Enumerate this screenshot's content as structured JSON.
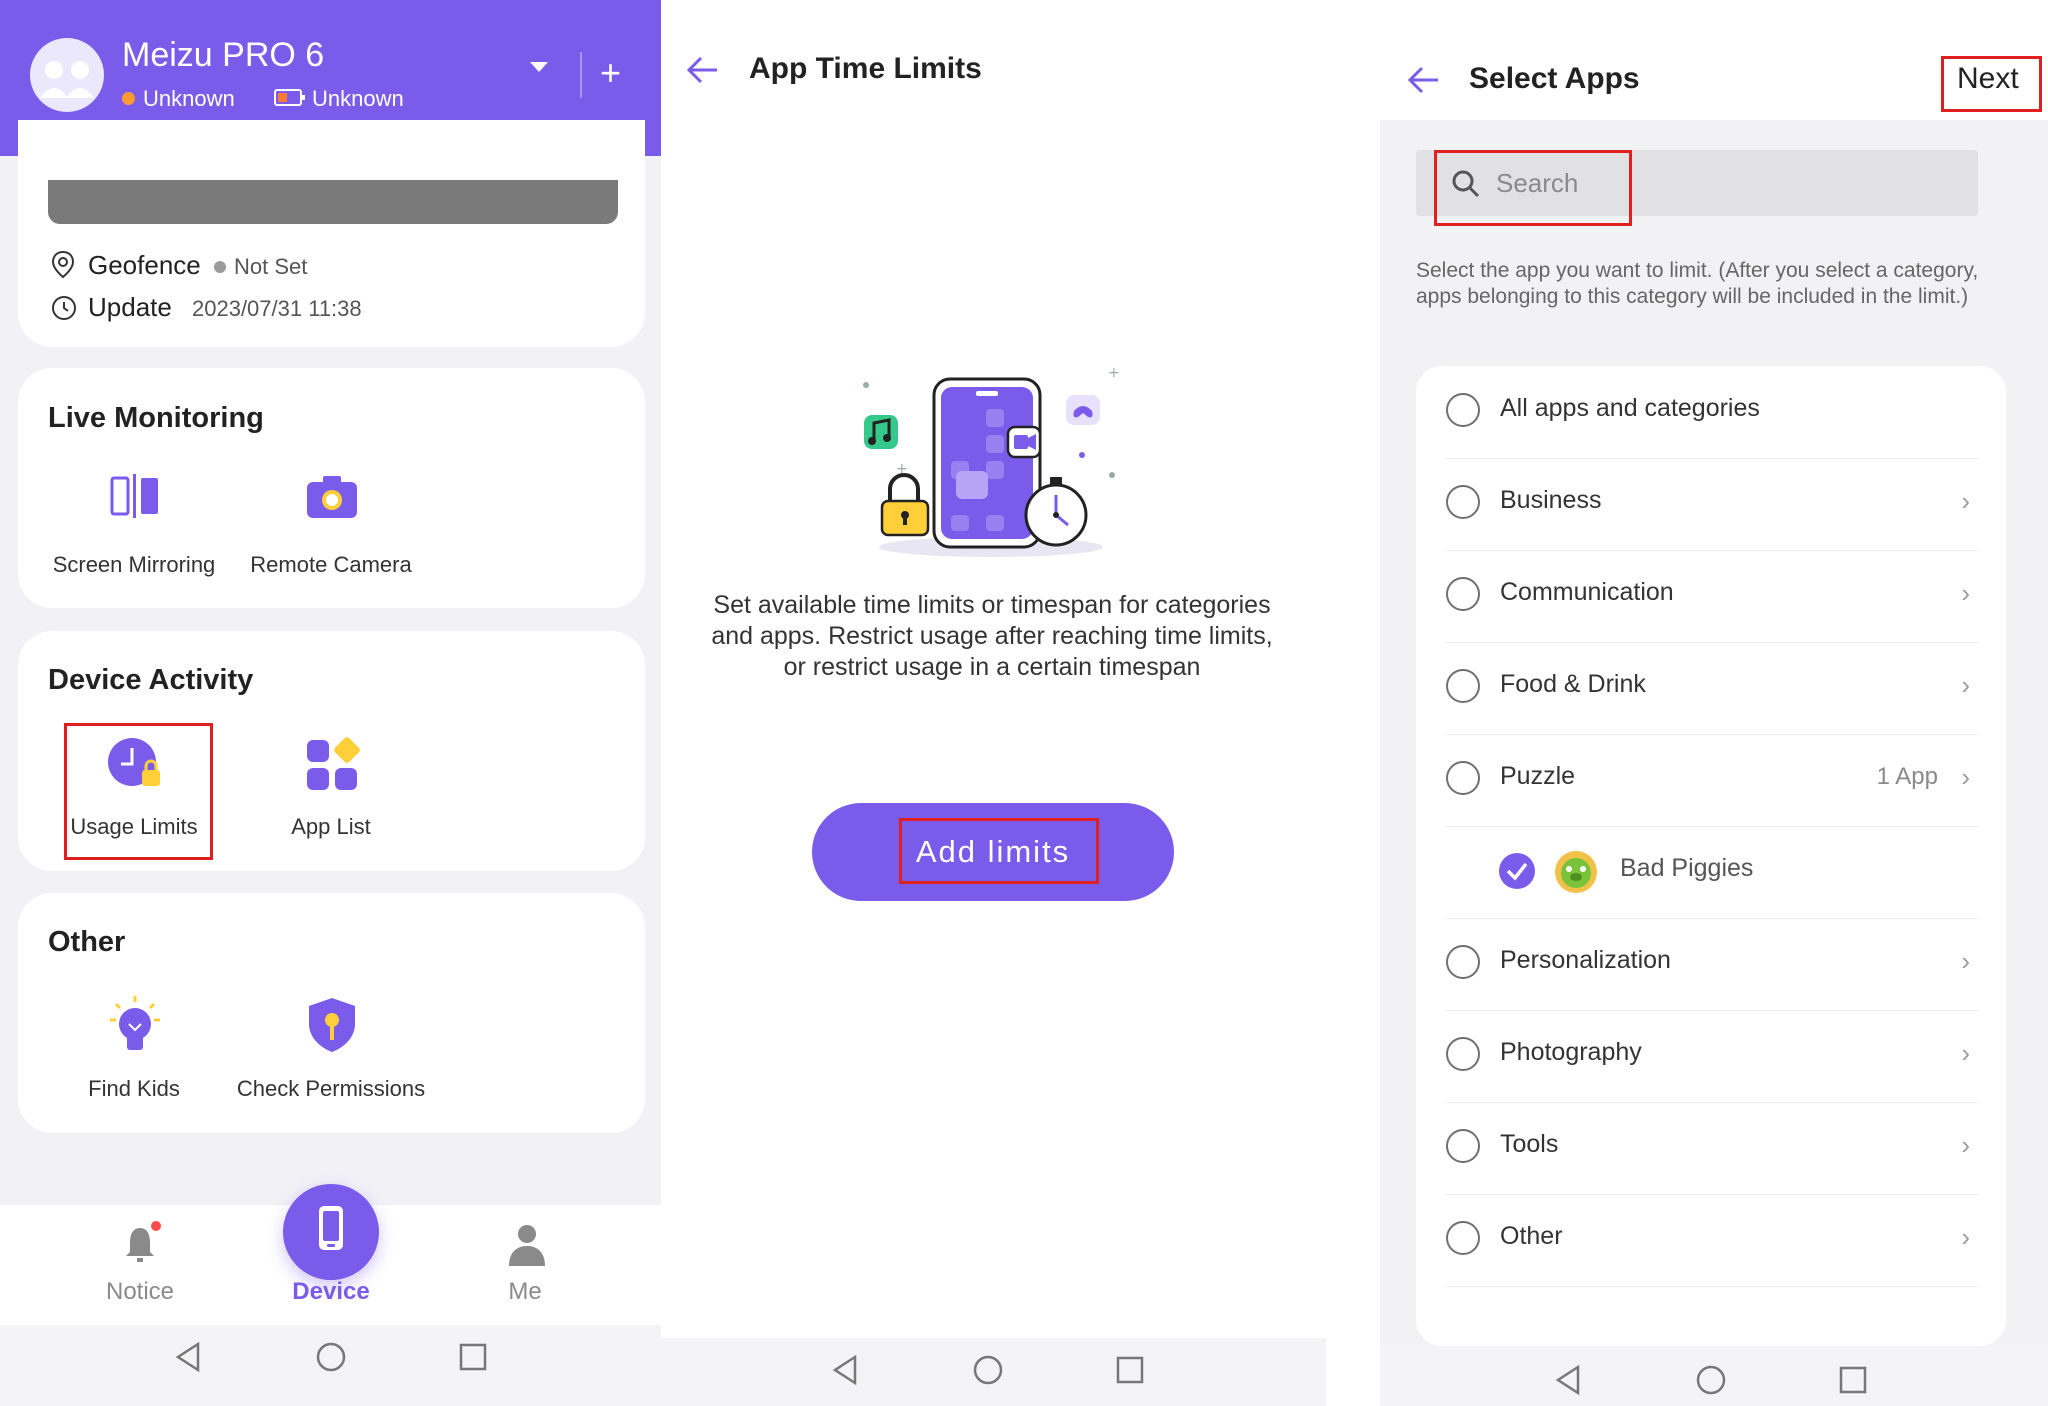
{
  "colors": {
    "accent": "#7b5bea",
    "highlight": "#e02020",
    "status_dot": "#ff9b30"
  },
  "panel1": {
    "device_name": "Meizu PRO 6",
    "status_location": "Unknown",
    "status_battery": "Unknown",
    "geofence_label": "Geofence",
    "geofence_value": "Not Set",
    "update_label": "Update",
    "update_value": "2023/07/31 11:38",
    "live_monitoring": {
      "title": "Live Monitoring",
      "items": [
        "Screen Mirroring",
        "Remote Camera"
      ]
    },
    "device_activity": {
      "title": "Device Activity",
      "items": [
        "Usage Limits",
        "App List"
      ]
    },
    "other": {
      "title": "Other",
      "items": [
        "Find Kids",
        "Check Permissions"
      ]
    },
    "nav": {
      "notice": "Notice",
      "device": "Device",
      "me": "Me"
    }
  },
  "panel2": {
    "title": "App Time Limits",
    "description": "Set available time limits or timespan for categories and apps. Restrict usage after reaching time limits, or restrict usage in a certain timespan",
    "add_button": "Add limits"
  },
  "panel3": {
    "title": "Select Apps",
    "next": "Next",
    "search_placeholder": "Search",
    "hint": "Select the app you want to limit. (After you select a category, apps belonging to this category will be included in the limit.)",
    "list": [
      {
        "label": "All apps and categories"
      },
      {
        "label": "Business"
      },
      {
        "label": "Communication"
      },
      {
        "label": "Food & Drink"
      },
      {
        "label": "Puzzle",
        "count": "1 App"
      },
      {
        "label": "Bad Piggies",
        "checked": true
      },
      {
        "label": "Personalization"
      },
      {
        "label": "Photography"
      },
      {
        "label": "Tools"
      },
      {
        "label": "Other"
      }
    ]
  }
}
